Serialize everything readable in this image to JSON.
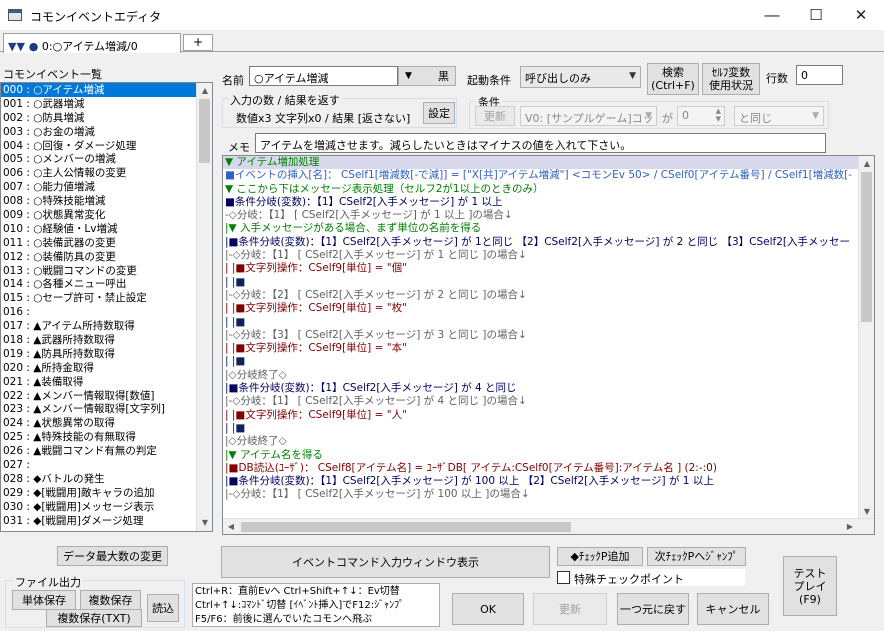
{
  "window": {
    "title": "コモンイベントエディタ",
    "minimize": "―",
    "maximize": "☐",
    "close": "✕"
  },
  "tabs": {
    "active": "0:○アイテム増減/0",
    "active_glyph": "▼▼ ●",
    "add": "+"
  },
  "list": {
    "header": "コモンイベント一覧",
    "items": [
      "000 : ○アイテム増減",
      "001 : ○武器増減",
      "002 : ○防具増減",
      "003 : ○お金の増減",
      "004 : ○回復・ダメージ処理",
      "005 : ○メンバーの増減",
      "006 : ○主人公情報の変更",
      "007 : ○能力値増減",
      "008 : ○特殊技能増減",
      "009 : ○状態異常変化",
      "010 : ○経験値・Lv増減",
      "011 : ○装備武器の変更",
      "012 : ○装備防具の変更",
      "013 : ○戦闘コマンドの変更",
      "014 : ○各種メニュー呼出",
      "015 : ○セーブ許可・禁止設定",
      "016 : ",
      "017 : ▲アイテム所持数取得",
      "018 : ▲武器所持数取得",
      "019 : ▲防具所持数取得",
      "020 : ▲所持金取得",
      "021 : ▲装備取得",
      "022 : ▲メンバー情報取得[数値]",
      "023 : ▲メンバー情報取得[文字列]",
      "024 : ▲状態異常の取得",
      "025 : ▲特殊技能の有無取得",
      "026 : ▲戦闘コマンド有無の判定",
      "027 : ",
      "028 : ◆バトルの発生",
      "029 : ◆[戦闘用]敵キャラの追加",
      "030 : ◆[戦闘用]メッセージ表示",
      "031 : ◆[戦闘用]ダメージ処理"
    ]
  },
  "name": {
    "label": "名前",
    "value": "○アイテム増減",
    "color_btn": "黒"
  },
  "trigger": {
    "label": "起動条件",
    "value": "呼び出しのみ"
  },
  "search_btn": "検索\n(Ctrl+F)",
  "selfvar_btn": "ｾﾙﾌ変数\n使用状況",
  "lines": {
    "label": "行数",
    "value": "0"
  },
  "io": {
    "title": "入力の数 / 結果を返す",
    "value": "数値x3 文字列x0 / 結果 [返さない]",
    "set_btn": "設定"
  },
  "cond": {
    "title": "条件",
    "update_btn": "更新",
    "var": "V0: [サンプルゲーム]コッ",
    "ga": "が",
    "num": "0",
    "op": "と同じ"
  },
  "memo": {
    "label": "メモ",
    "value": "アイテムを増減させます。減らしたいときはマイナスの値を入れて下さい。"
  },
  "commands": [
    {
      "t": "▼ アイテム増加処理",
      "c": "c-green",
      "hl": true
    },
    {
      "t": "■イベントの挿入[名]： CSelf1[増減数[-で減]] = [\"X[共]アイテム増減\"] <コモンEv 50>  / CSelf0[アイテム番号] / CSelf1[増減数[-",
      "c": "c-blue"
    },
    {
      "t": "▼ ここから下はメッセージ表示処理（セルフ2が1以上のときのみ）",
      "c": "c-green"
    },
    {
      "t": "■条件分岐(変数)：【1】CSelf2[入手メッセージ]  が  1 以上",
      "c": "c-navy"
    },
    {
      "t": "-◇分岐：【1】 [ CSelf2[入手メッセージ]  が  1 以上 ]の場合↓",
      "c": "c-gray"
    },
    {
      "t": "|▼ 入手メッセージがある場合、まず単位の名前を得る",
      "c": "c-green"
    },
    {
      "t": "|■条件分岐(変数)：【1】CSelf2[入手メッセージ]  が  1と同じ 【2】CSelf2[入手メッセージ]  が  2 と同じ 【3】CSelf2[入手メッセー",
      "c": "c-navy"
    },
    {
      "t": "|-◇分岐：【1】 [ CSelf2[入手メッセージ]  が  1 と同じ ]の場合↓",
      "c": "c-gray"
    },
    {
      "t": "| |■文字列操作：CSelf9[単位] = \"個\"",
      "c": "c-red"
    },
    {
      "t": "| |■",
      "c": "c-dark"
    },
    {
      "t": "|-◇分岐：【2】 [ CSelf2[入手メッセージ]  が  2 と同じ ]の場合↓",
      "c": "c-gray"
    },
    {
      "t": "| |■文字列操作：CSelf9[単位] = \"枚\"",
      "c": "c-red"
    },
    {
      "t": "| |■",
      "c": "c-dark"
    },
    {
      "t": "|-◇分岐：【3】 [ CSelf2[入手メッセージ]  が  3 と同じ ]の場合↓",
      "c": "c-gray"
    },
    {
      "t": "| |■文字列操作：CSelf9[単位] = \"本\"",
      "c": "c-red"
    },
    {
      "t": "| |■",
      "c": "c-dark"
    },
    {
      "t": "|◇分岐終了◇",
      "c": "c-gray"
    },
    {
      "t": "|■条件分岐(変数)：【1】CSelf2[入手メッセージ]  が  4 と同じ",
      "c": "c-navy"
    },
    {
      "t": "|-◇分岐：【1】 [ CSelf2[入手メッセージ]  が  4 と同じ ]の場合↓",
      "c": "c-gray"
    },
    {
      "t": "| |■文字列操作：CSelf9[単位] = \"人\"",
      "c": "c-red"
    },
    {
      "t": "| |■",
      "c": "c-dark"
    },
    {
      "t": "|◇分岐終了◇",
      "c": "c-gray"
    },
    {
      "t": "|▼ アイテム名を得る",
      "c": "c-green"
    },
    {
      "t": "|■DB読込(ﾕｰｻﾞ)：  CSelf8[アイテム名] = ﾕｰｻﾞDB[ アイテム:CSelf0[アイテム番号]:アイテム名 ] (2:-:0)",
      "c": "c-red"
    },
    {
      "t": "|■条件分岐(変数)：【1】CSelf2[入手メッセージ]  が  100 以上 【2】CSelf2[入手メッセージ]  が  1 以上",
      "c": "c-navy"
    },
    {
      "t": "|-◇分岐：【1】 [ CSelf2[入手メッセージ]  が  100 以上 ]の場合↓",
      "c": "c-gray"
    }
  ],
  "buttons": {
    "data_max": "データ最大数の変更",
    "file_group": "ファイル出力",
    "single_save": "単体保存",
    "multi_save": "複数保存",
    "load": "読込",
    "multi_save_txt": "複数保存(TXT)",
    "cmd_window": "イベントコマンド入力ウィンドウ表示",
    "checkpoint_add": "◆ﾁｪｯｸP追加",
    "next_checkpoint": "次ﾁｪｯｸPへｼﾞｬﾝﾌﾟ",
    "special_checkpoint": "特殊チェックポイント",
    "ok": "OK",
    "update": "更新",
    "undo": "一つ元に戻す",
    "cancel": "キャンセル",
    "test_play": "テスト\nプレイ\n(F9)"
  },
  "hints": [
    "Ctrl+R：直前Evへ  Ctrl+Shift+↑↓：Ev切替",
    "Ctrl+↑↓:ｺﾏﾝﾄﾞ切替 [ｲﾍﾞﾝﾄ挿入]でF12:ｼﾞｬﾝﾌﾟ",
    "F5/F6：前後に選んでいたコモンへ飛ぶ"
  ]
}
